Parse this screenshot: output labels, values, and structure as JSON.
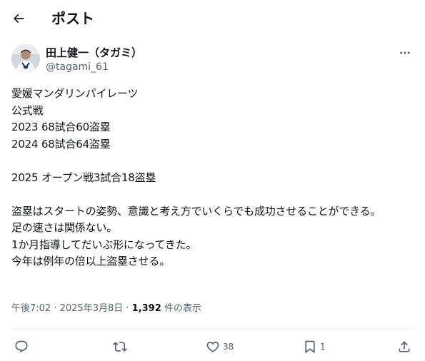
{
  "header": {
    "title": "ポスト",
    "back_icon": "arrow-left-icon"
  },
  "author": {
    "display_name": "田上健一（タガミ）",
    "handle": "@tagami_61",
    "more_icon": "more-horizontal-icon"
  },
  "tweet": {
    "text": "愛媛マンダリンパイレーツ\n公式戦\n2023 68試合60盗塁\n2024 68試合64盗塁\n\n2025 オープン戦3試合18盗塁\n\n盗塁はスタートの姿勢、意識と考え方でいくらでも成功させることができる。\n足の速さは関係ない。\n1か月指導してだいぶ形になってきた。\n今年は例年の倍以上盗塁させる。"
  },
  "meta": {
    "time": "午後7:02",
    "separator": " · ",
    "date": "2025年3月8日",
    "separator2": " · ",
    "views_count": "1,392",
    "views_label": " 件の表示"
  },
  "actions": {
    "reply_icon": "reply-icon",
    "retweet_icon": "retweet-icon",
    "like_icon": "heart-icon",
    "like_count": "38",
    "bookmark_icon": "bookmark-icon",
    "bookmark_count": "1",
    "share_icon": "share-icon"
  },
  "colors": {
    "text": "#0f1419",
    "secondary": "#536471",
    "divider": "#eff3f4"
  }
}
